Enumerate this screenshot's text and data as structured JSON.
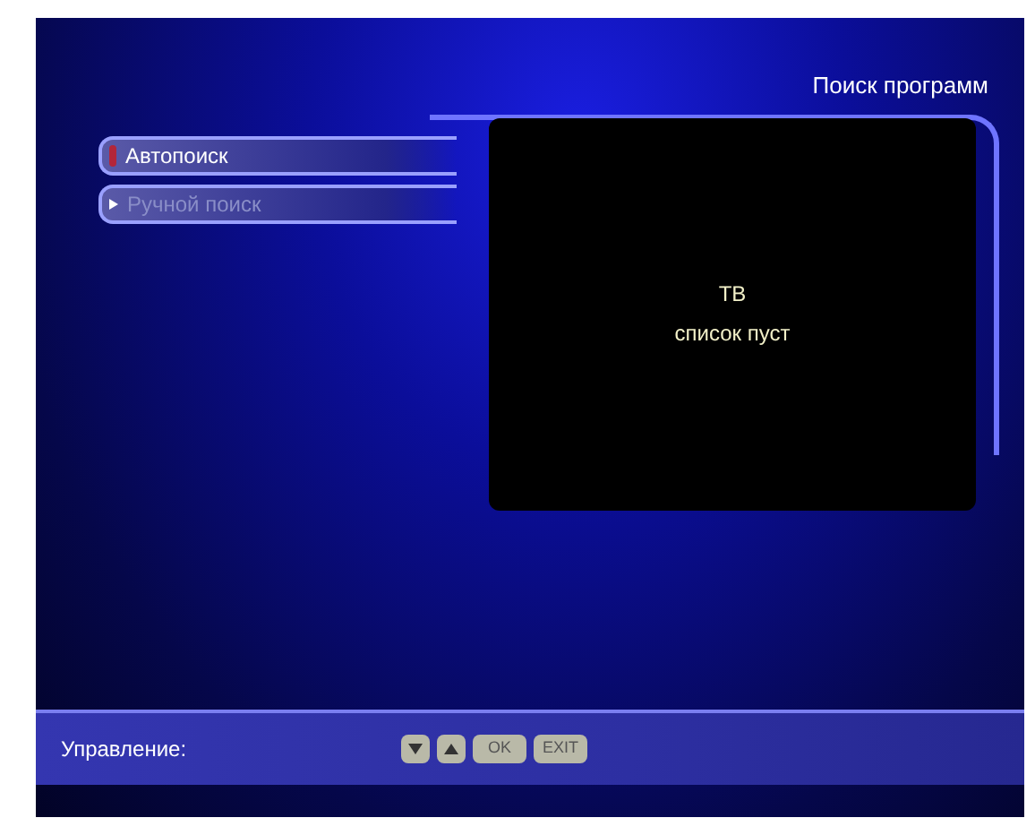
{
  "title": "Поиск программ",
  "menu": [
    {
      "label": "Автопоиск",
      "selected": true
    },
    {
      "label": "Ручной поиск",
      "selected": false
    }
  ],
  "preview": {
    "channel_type": "ТВ",
    "message": "список пуст"
  },
  "control_bar": {
    "label": "Управление:",
    "keys": [
      {
        "kind": "arrow-down"
      },
      {
        "kind": "arrow-up"
      },
      {
        "kind": "text",
        "label": "OK"
      },
      {
        "kind": "text",
        "label": "EXIT"
      }
    ]
  }
}
